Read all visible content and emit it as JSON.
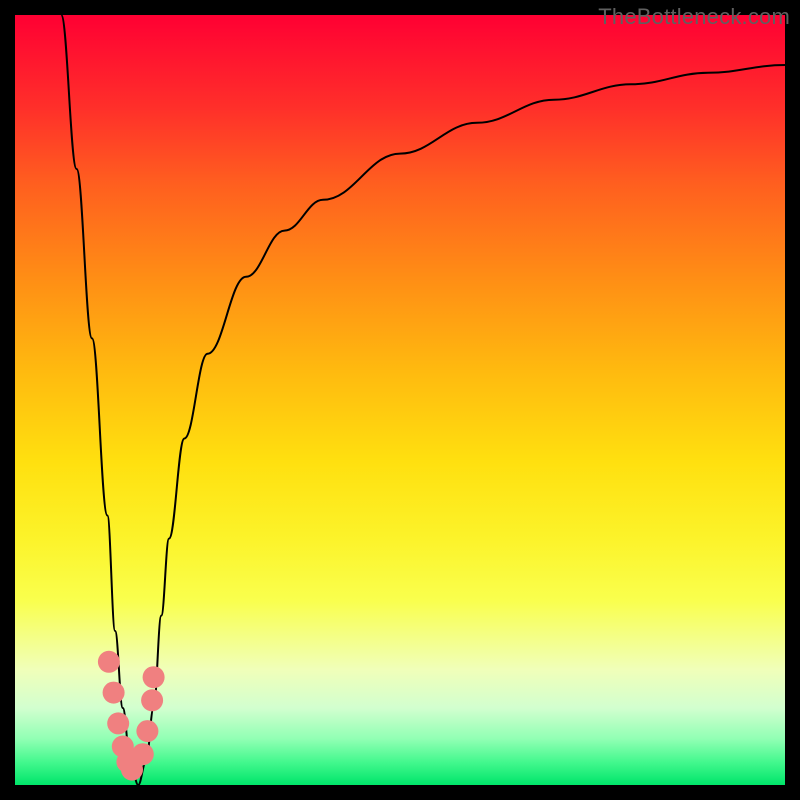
{
  "watermark": {
    "text": "TheBottleneck.com"
  },
  "chart_data": {
    "type": "line",
    "title": "",
    "xlabel": "",
    "ylabel": "",
    "xlim": [
      0,
      100
    ],
    "ylim": [
      0,
      100
    ],
    "grid": false,
    "series": [
      {
        "name": "bottleneck-curve",
        "color": "#000000",
        "x": [
          6,
          8,
          10,
          12,
          13,
          14,
          15,
          16,
          17,
          18,
          19,
          20,
          22,
          25,
          30,
          35,
          40,
          50,
          60,
          70,
          80,
          90,
          100
        ],
        "y": [
          100,
          80,
          58,
          35,
          20,
          10,
          3,
          0,
          3,
          10,
          22,
          32,
          45,
          56,
          66,
          72,
          76,
          82,
          86,
          89,
          91,
          92.5,
          93.5
        ]
      }
    ],
    "annotations": [
      {
        "type": "marker-cluster",
        "name": "pink-dots",
        "color": "#f08080",
        "x": [
          12.2,
          12.8,
          13.4,
          14.0,
          14.6,
          15.2,
          16.6,
          17.2,
          17.8,
          18.0
        ],
        "y": [
          16,
          12,
          8,
          5,
          3,
          2,
          4,
          7,
          11,
          14
        ]
      }
    ],
    "background": {
      "gradient": [
        "#ff0033",
        "#ff5f1f",
        "#ffb90f",
        "#fcf32a",
        "#f9ff4d",
        "#d2ffcf",
        "#00e56a"
      ]
    }
  }
}
